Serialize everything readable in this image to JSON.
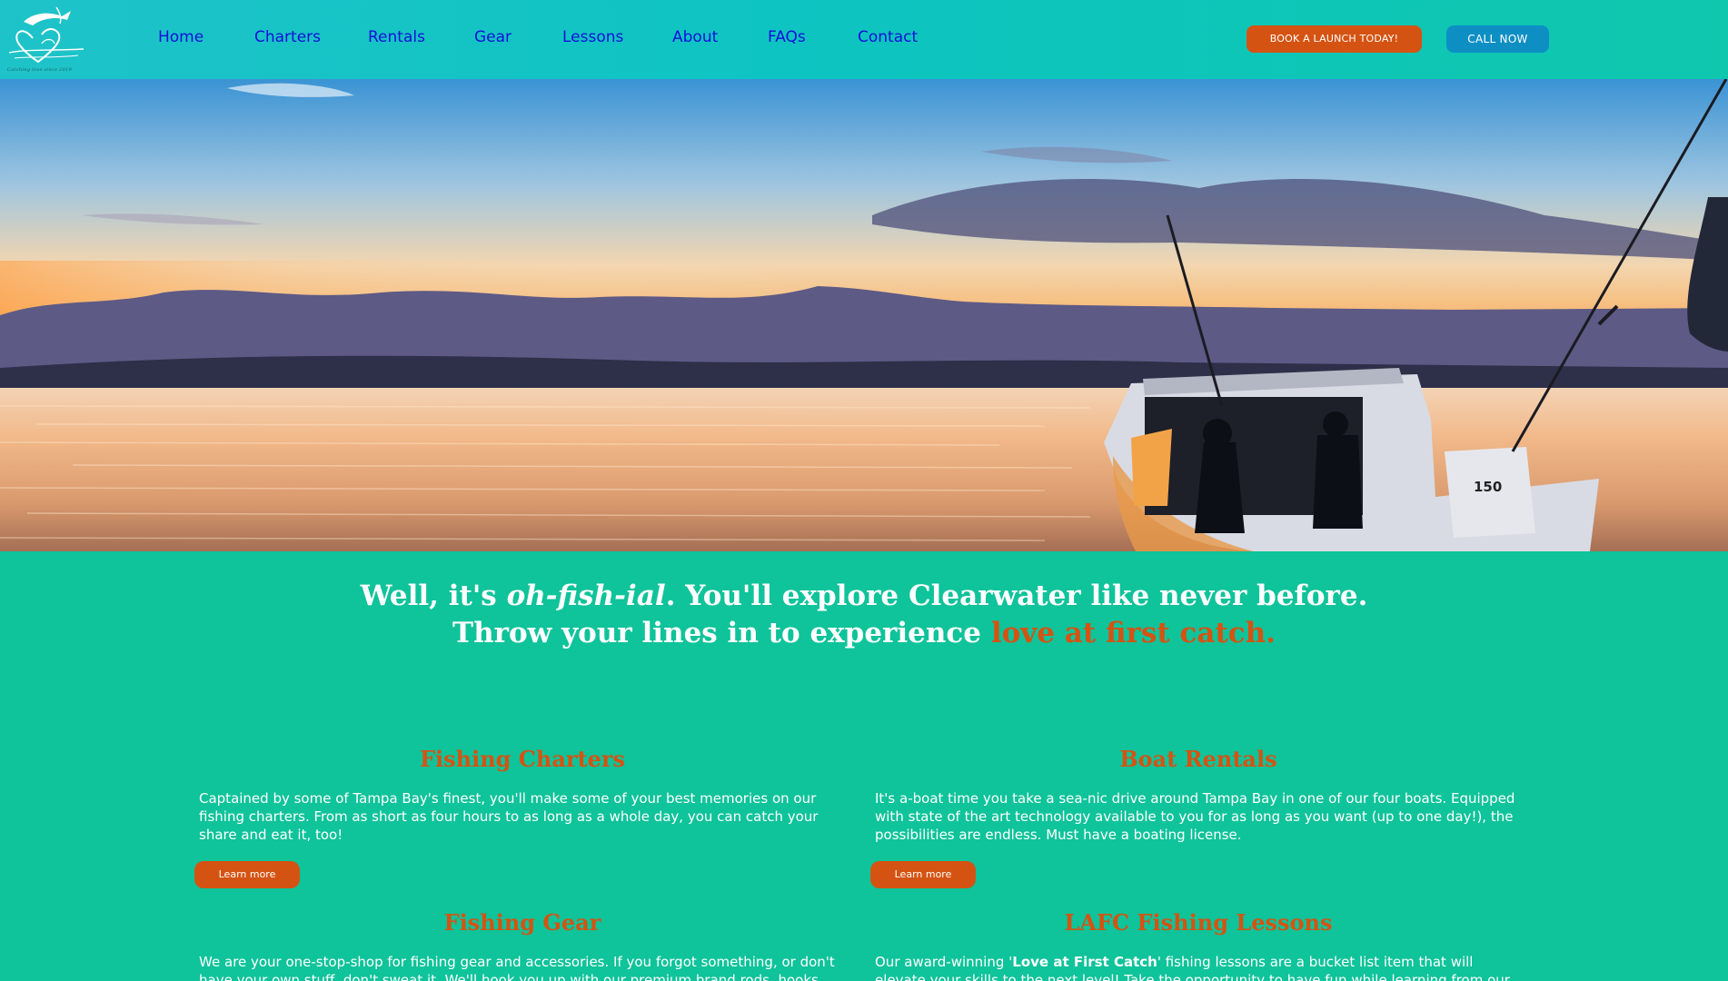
{
  "header": {
    "logo_tagline": "Catching love since 2019",
    "nav": [
      {
        "label": "Home"
      },
      {
        "label": "Charters"
      },
      {
        "label": "Rentals"
      },
      {
        "label": "Gear"
      },
      {
        "label": "Lessons"
      },
      {
        "label": "About"
      },
      {
        "label": "FAQs"
      },
      {
        "label": "Contact"
      }
    ],
    "book_label": "BOOK A LAUNCH TODAY!",
    "call_label": "CALL NOW"
  },
  "hero": {
    "outboard_label": "150"
  },
  "headline": {
    "line1_a": "Well, it's ",
    "line1_em": "oh-fish-ial",
    "line1_b": ". You'll explore Clearwater like never before.",
    "line2_a": "Throw your lines in to experience ",
    "line2_accent": "love at first catch."
  },
  "services": [
    {
      "title": "Fishing Charters",
      "body": "Captained by some of Tampa Bay's finest, you'll make some of your best memories on our fishing charters. From as short as four hours to as long as a whole day, you can catch your share and eat it, too!",
      "button": "Learn more"
    },
    {
      "title": "Boat Rentals",
      "body": "It's a-boat time you take a sea-nic drive around Tampa Bay in one of our four boats. Equipped with state of the art technology available to you for as long as you want (up to one day!), the possibilities are endless. Must have a boating license.",
      "button": "Learn more"
    },
    {
      "title": "Fishing Gear",
      "body": "We are your one-stop-shop for fishing gear and accessories. If you forgot something, or don't have your own stuff, don't sweat it. We'll hook you up with our premium brand rods, hooks, and more."
    },
    {
      "title": "LAFC Fishing Lessons",
      "body_a": "Our award-winning '",
      "body_bold": "Love at First Catch",
      "body_b": "' fishing lessons are a bucket list item that will elevate your skills to the next level! Take the opportunity to have fun while learning from our world-class guides."
    }
  ],
  "colors": {
    "header_teal": "#1ec3c9",
    "page_green": "#0fc39a",
    "accent_orange": "#d55312",
    "call_blue": "#0d8fc4",
    "nav_blue": "#1010d8"
  }
}
